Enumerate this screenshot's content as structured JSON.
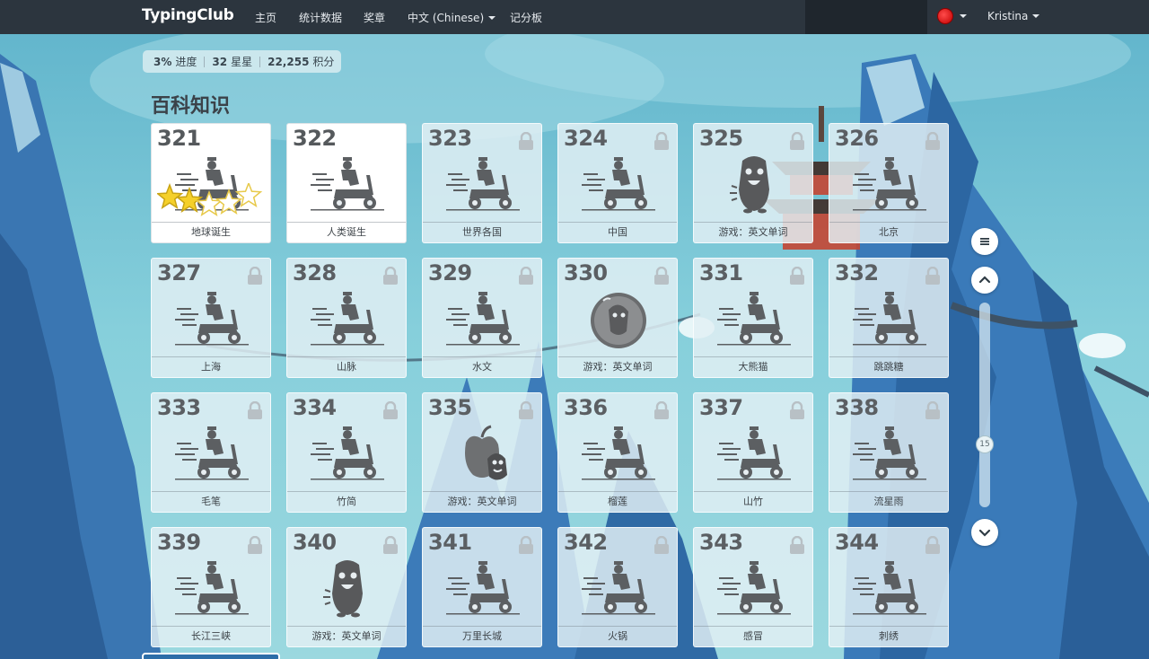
{
  "nav": {
    "logo": "TypingClub",
    "home": "主页",
    "stats": "统计数据",
    "badges": "奖章",
    "language": "中文 (Chinese)",
    "scoreboard": "记分板",
    "user": "Kristina"
  },
  "stats": {
    "progress_value": "3%",
    "progress_label": "进度",
    "stars_value": "32",
    "stars_label": "星星",
    "points_value": "22,255",
    "points_label": "积分"
  },
  "section_title": "百科知识",
  "lessons": [
    {
      "num": "321",
      "label": "地球诞生",
      "locked": false,
      "icon": "scooter",
      "stars_earned": 2,
      "stars_total": 5
    },
    {
      "num": "322",
      "label": "人类诞生",
      "locked": false,
      "icon": "scooter"
    },
    {
      "num": "323",
      "label": "世界各国",
      "locked": true,
      "icon": "scooter"
    },
    {
      "num": "324",
      "label": "中国",
      "locked": true,
      "icon": "scooter"
    },
    {
      "num": "325",
      "label": "游戏：英文单词",
      "locked": true,
      "icon": "monster"
    },
    {
      "num": "326",
      "label": "北京",
      "locked": true,
      "icon": "scooter"
    },
    {
      "num": "327",
      "label": "上海",
      "locked": true,
      "icon": "scooter"
    },
    {
      "num": "328",
      "label": "山脉",
      "locked": true,
      "icon": "scooter"
    },
    {
      "num": "329",
      "label": "水文",
      "locked": true,
      "icon": "scooter"
    },
    {
      "num": "330",
      "label": "游戏：英文单词",
      "locked": true,
      "icon": "bubble"
    },
    {
      "num": "331",
      "label": "大熊猫",
      "locked": true,
      "icon": "scooter"
    },
    {
      "num": "332",
      "label": "跳跳糖",
      "locked": true,
      "icon": "scooter"
    },
    {
      "num": "333",
      "label": "毛笔",
      "locked": true,
      "icon": "scooter"
    },
    {
      "num": "334",
      "label": "竹简",
      "locked": true,
      "icon": "scooter"
    },
    {
      "num": "335",
      "label": "游戏：英文单词",
      "locked": true,
      "icon": "apple"
    },
    {
      "num": "336",
      "label": "榴莲",
      "locked": true,
      "icon": "scooter"
    },
    {
      "num": "337",
      "label": "山竹",
      "locked": true,
      "icon": "scooter"
    },
    {
      "num": "338",
      "label": "流星雨",
      "locked": true,
      "icon": "scooter"
    },
    {
      "num": "339",
      "label": "长江三峡",
      "locked": true,
      "icon": "scooter"
    },
    {
      "num": "340",
      "label": "游戏：英文单词",
      "locked": true,
      "icon": "monster"
    },
    {
      "num": "341",
      "label": "万里长城",
      "locked": true,
      "icon": "scooter"
    },
    {
      "num": "342",
      "label": "火锅",
      "locked": true,
      "icon": "scooter"
    },
    {
      "num": "343",
      "label": "感冒",
      "locked": true,
      "icon": "scooter"
    },
    {
      "num": "344",
      "label": "刺绣",
      "locked": true,
      "icon": "scooter"
    }
  ],
  "scroll": {
    "position_label": "15"
  },
  "colors": {
    "navbar": "#2c353e",
    "sky": "#7cc6d8",
    "mountain": "#3a78b8"
  }
}
